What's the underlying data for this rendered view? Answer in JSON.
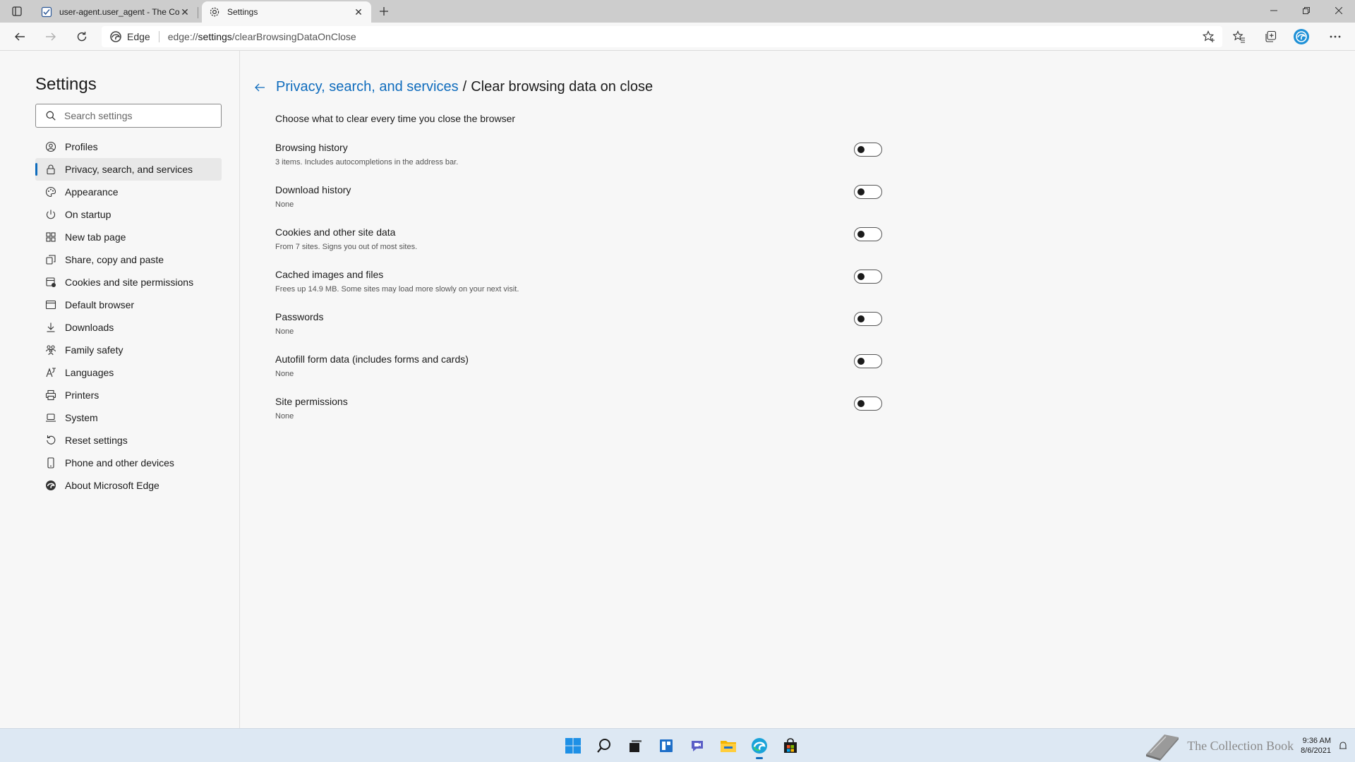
{
  "tabs": [
    {
      "title": "user-agent.user_agent - The Coll",
      "icon": "document-icon",
      "active": false
    },
    {
      "title": "Settings",
      "icon": "gear-icon",
      "active": true
    }
  ],
  "address_bar": {
    "identity_label": "Edge",
    "url_prefix": "edge://",
    "url_host": "settings",
    "url_path": "/clearBrowsingDataOnClose"
  },
  "sidebar": {
    "title": "Settings",
    "search_placeholder": "Search settings",
    "items": [
      {
        "label": "Profiles",
        "icon": "person-icon"
      },
      {
        "label": "Privacy, search, and services",
        "icon": "lock-icon",
        "selected": true
      },
      {
        "label": "Appearance",
        "icon": "palette-icon"
      },
      {
        "label": "On startup",
        "icon": "power-icon"
      },
      {
        "label": "New tab page",
        "icon": "grid-icon"
      },
      {
        "label": "Share, copy and paste",
        "icon": "share-icon"
      },
      {
        "label": "Cookies and site permissions",
        "icon": "cookie-icon"
      },
      {
        "label": "Default browser",
        "icon": "browser-icon"
      },
      {
        "label": "Downloads",
        "icon": "download-icon"
      },
      {
        "label": "Family safety",
        "icon": "family-icon"
      },
      {
        "label": "Languages",
        "icon": "language-icon"
      },
      {
        "label": "Printers",
        "icon": "printer-icon"
      },
      {
        "label": "System",
        "icon": "laptop-icon"
      },
      {
        "label": "Reset settings",
        "icon": "reset-icon"
      },
      {
        "label": "Phone and other devices",
        "icon": "phone-icon"
      },
      {
        "label": "About Microsoft Edge",
        "icon": "edge-icon"
      }
    ]
  },
  "main": {
    "breadcrumb_parent": "Privacy, search, and services",
    "breadcrumb_separator": "/",
    "breadcrumb_current": "Clear browsing data on close",
    "intro": "Choose what to clear every time you close the browser",
    "rows": [
      {
        "title": "Browsing history",
        "subtitle": "3 items. Includes autocompletions in the address bar.",
        "enabled": false
      },
      {
        "title": "Download history",
        "subtitle": "None",
        "enabled": false
      },
      {
        "title": "Cookies and other site data",
        "subtitle": "From 7 sites. Signs you out of most sites.",
        "enabled": false
      },
      {
        "title": "Cached images and files",
        "subtitle": "Frees up 14.9 MB. Some sites may load more slowly on your next visit.",
        "enabled": false
      },
      {
        "title": "Passwords",
        "subtitle": "None",
        "enabled": false
      },
      {
        "title": "Autofill form data (includes forms and cards)",
        "subtitle": "None",
        "enabled": false
      },
      {
        "title": "Site permissions",
        "subtitle": "None",
        "enabled": false
      }
    ]
  },
  "taskbar": {
    "apps": [
      "windows-start-icon",
      "search-icon",
      "task-view-icon",
      "widgets-icon",
      "chat-icon",
      "file-explorer-icon",
      "edge-icon",
      "store-icon"
    ],
    "watermark": "The Collection Book",
    "time": "9:36 AM",
    "date": "8/6/2021"
  },
  "colors": {
    "accent": "#0f6cbd",
    "background": "#f7f7f7",
    "taskbar": "#dde8f3"
  }
}
